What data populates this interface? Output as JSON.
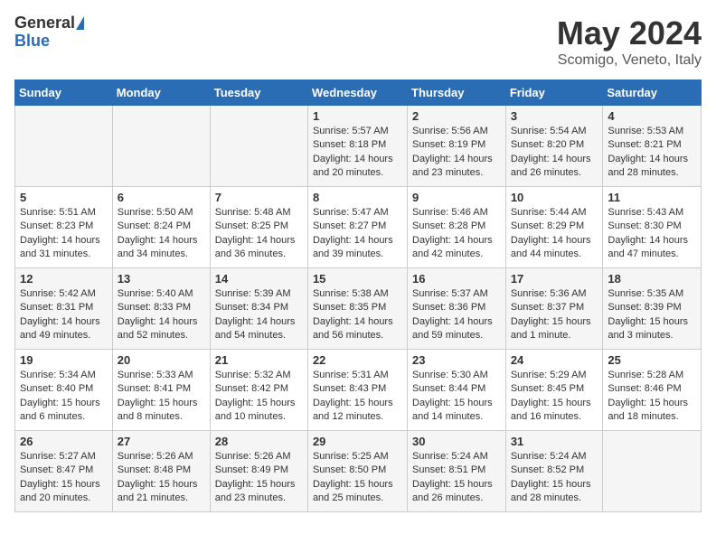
{
  "header": {
    "logo_general": "General",
    "logo_blue": "Blue",
    "title": "May 2024",
    "location": "Scomigo, Veneto, Italy"
  },
  "days_of_week": [
    "Sunday",
    "Monday",
    "Tuesday",
    "Wednesday",
    "Thursday",
    "Friday",
    "Saturday"
  ],
  "weeks": [
    [
      {
        "day": "",
        "info": ""
      },
      {
        "day": "",
        "info": ""
      },
      {
        "day": "",
        "info": ""
      },
      {
        "day": "1",
        "info": "Sunrise: 5:57 AM\nSunset: 8:18 PM\nDaylight: 14 hours and 20 minutes."
      },
      {
        "day": "2",
        "info": "Sunrise: 5:56 AM\nSunset: 8:19 PM\nDaylight: 14 hours and 23 minutes."
      },
      {
        "day": "3",
        "info": "Sunrise: 5:54 AM\nSunset: 8:20 PM\nDaylight: 14 hours and 26 minutes."
      },
      {
        "day": "4",
        "info": "Sunrise: 5:53 AM\nSunset: 8:21 PM\nDaylight: 14 hours and 28 minutes."
      }
    ],
    [
      {
        "day": "5",
        "info": "Sunrise: 5:51 AM\nSunset: 8:23 PM\nDaylight: 14 hours and 31 minutes."
      },
      {
        "day": "6",
        "info": "Sunrise: 5:50 AM\nSunset: 8:24 PM\nDaylight: 14 hours and 34 minutes."
      },
      {
        "day": "7",
        "info": "Sunrise: 5:48 AM\nSunset: 8:25 PM\nDaylight: 14 hours and 36 minutes."
      },
      {
        "day": "8",
        "info": "Sunrise: 5:47 AM\nSunset: 8:27 PM\nDaylight: 14 hours and 39 minutes."
      },
      {
        "day": "9",
        "info": "Sunrise: 5:46 AM\nSunset: 8:28 PM\nDaylight: 14 hours and 42 minutes."
      },
      {
        "day": "10",
        "info": "Sunrise: 5:44 AM\nSunset: 8:29 PM\nDaylight: 14 hours and 44 minutes."
      },
      {
        "day": "11",
        "info": "Sunrise: 5:43 AM\nSunset: 8:30 PM\nDaylight: 14 hours and 47 minutes."
      }
    ],
    [
      {
        "day": "12",
        "info": "Sunrise: 5:42 AM\nSunset: 8:31 PM\nDaylight: 14 hours and 49 minutes."
      },
      {
        "day": "13",
        "info": "Sunrise: 5:40 AM\nSunset: 8:33 PM\nDaylight: 14 hours and 52 minutes."
      },
      {
        "day": "14",
        "info": "Sunrise: 5:39 AM\nSunset: 8:34 PM\nDaylight: 14 hours and 54 minutes."
      },
      {
        "day": "15",
        "info": "Sunrise: 5:38 AM\nSunset: 8:35 PM\nDaylight: 14 hours and 56 minutes."
      },
      {
        "day": "16",
        "info": "Sunrise: 5:37 AM\nSunset: 8:36 PM\nDaylight: 14 hours and 59 minutes."
      },
      {
        "day": "17",
        "info": "Sunrise: 5:36 AM\nSunset: 8:37 PM\nDaylight: 15 hours and 1 minute."
      },
      {
        "day": "18",
        "info": "Sunrise: 5:35 AM\nSunset: 8:39 PM\nDaylight: 15 hours and 3 minutes."
      }
    ],
    [
      {
        "day": "19",
        "info": "Sunrise: 5:34 AM\nSunset: 8:40 PM\nDaylight: 15 hours and 6 minutes."
      },
      {
        "day": "20",
        "info": "Sunrise: 5:33 AM\nSunset: 8:41 PM\nDaylight: 15 hours and 8 minutes."
      },
      {
        "day": "21",
        "info": "Sunrise: 5:32 AM\nSunset: 8:42 PM\nDaylight: 15 hours and 10 minutes."
      },
      {
        "day": "22",
        "info": "Sunrise: 5:31 AM\nSunset: 8:43 PM\nDaylight: 15 hours and 12 minutes."
      },
      {
        "day": "23",
        "info": "Sunrise: 5:30 AM\nSunset: 8:44 PM\nDaylight: 15 hours and 14 minutes."
      },
      {
        "day": "24",
        "info": "Sunrise: 5:29 AM\nSunset: 8:45 PM\nDaylight: 15 hours and 16 minutes."
      },
      {
        "day": "25",
        "info": "Sunrise: 5:28 AM\nSunset: 8:46 PM\nDaylight: 15 hours and 18 minutes."
      }
    ],
    [
      {
        "day": "26",
        "info": "Sunrise: 5:27 AM\nSunset: 8:47 PM\nDaylight: 15 hours and 20 minutes."
      },
      {
        "day": "27",
        "info": "Sunrise: 5:26 AM\nSunset: 8:48 PM\nDaylight: 15 hours and 21 minutes."
      },
      {
        "day": "28",
        "info": "Sunrise: 5:26 AM\nSunset: 8:49 PM\nDaylight: 15 hours and 23 minutes."
      },
      {
        "day": "29",
        "info": "Sunrise: 5:25 AM\nSunset: 8:50 PM\nDaylight: 15 hours and 25 minutes."
      },
      {
        "day": "30",
        "info": "Sunrise: 5:24 AM\nSunset: 8:51 PM\nDaylight: 15 hours and 26 minutes."
      },
      {
        "day": "31",
        "info": "Sunrise: 5:24 AM\nSunset: 8:52 PM\nDaylight: 15 hours and 28 minutes."
      },
      {
        "day": "",
        "info": ""
      }
    ]
  ]
}
